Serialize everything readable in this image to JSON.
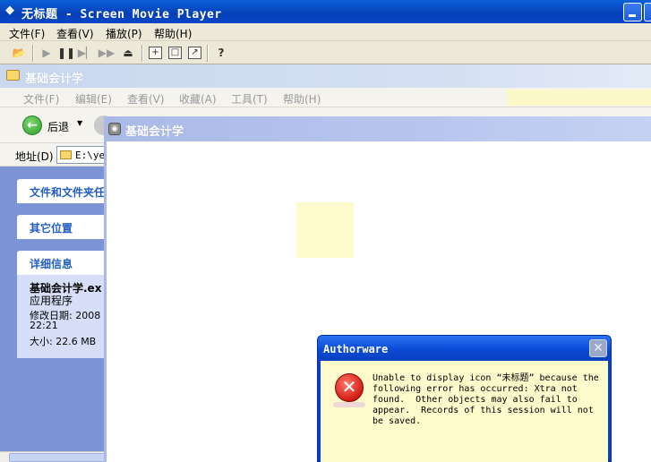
{
  "player": {
    "title": "无标题 - Screen Movie Player",
    "app_icon": "diamond-arrows-icon",
    "menu": [
      "文件(F)",
      "查看(V)",
      "播放(P)",
      "帮助(H)"
    ],
    "toolbar_icons": [
      "open-folder-icon",
      "play-icon",
      "pause-icon",
      "step-forward-icon",
      "fast-forward-icon",
      "eject-icon",
      "fit-window-icon",
      "full-screen-icon",
      "restore-icon",
      "help-icon"
    ]
  },
  "explorer": {
    "title": "基础会计学",
    "menu": [
      "文件(F)",
      "编辑(E)",
      "查看(V)",
      "收藏(A)",
      "工具(T)",
      "帮助(H)"
    ],
    "back_label": "后退",
    "address_label": "地址(D)",
    "address_value": "E:\\ye",
    "task_pane": {
      "sections": [
        "文件和文件夹任",
        "其它位置",
        "详细信息"
      ],
      "file_name": "基础会计学.ex",
      "file_type": "应用程序",
      "modified_label": "修改日期: 2008",
      "modified_time": "22:21",
      "size": "大小: 22.6 MB"
    }
  },
  "movie_window": {
    "title": "基础会计学"
  },
  "dialog": {
    "title": "Authorware",
    "close_glyph": "✕",
    "message": "Unable to display icon “未标题” because the\nfollowing error has occurred: Xtra not\nfound.  Other objects may also fail to\nappear.  Records of this session will not\nbe saved."
  }
}
